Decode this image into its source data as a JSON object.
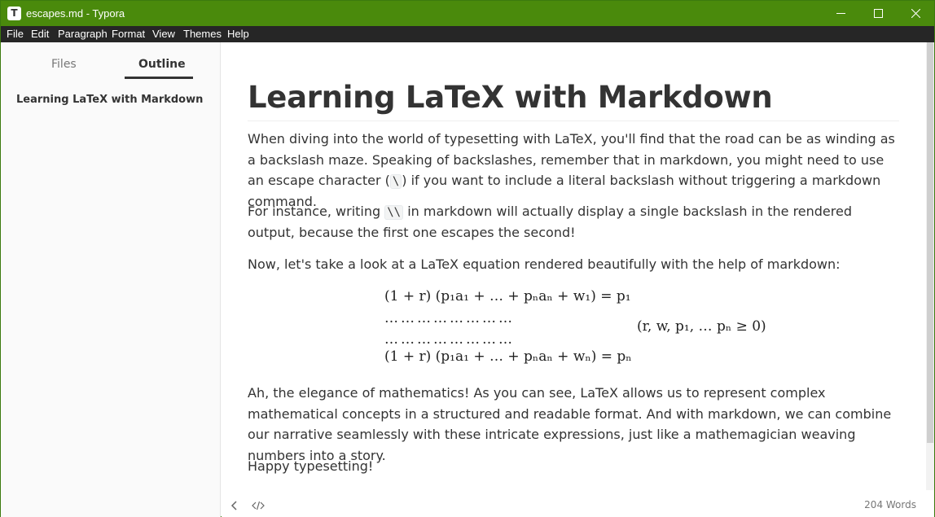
{
  "window": {
    "app_letter": "T",
    "title": "escapes.md - Typora"
  },
  "menu": [
    "File",
    "Edit",
    "Paragraph",
    "Format",
    "View",
    "Themes",
    "Help"
  ],
  "sidebar": {
    "tabs": {
      "files": "Files",
      "outline": "Outline"
    },
    "outline_items": [
      "Learning LaTeX with Markdown"
    ]
  },
  "document": {
    "title": "Learning LaTeX with Markdown",
    "p1_a": "When diving into the world of typesetting with LaTeX, you'll find that the road can be as winding as a backslash maze. Speaking of backslashes, remember that in markdown, you might need to use an escape character (",
    "p1_code": "\\",
    "p1_b": ") if you want to include a literal backslash without triggering a markdown command.",
    "p2_a": "For instance, writing ",
    "p2_code": "\\\\",
    "p2_b": " in markdown will actually display a single backslash in the rendered output, because the first one escapes the second!",
    "p3": "Now, let's take a look at a LaTeX equation rendered beautifully with the help of markdown:",
    "math": {
      "line1": "(1 + r) (p₁a₁ + … + pₙaₙ + w₁) = p₁",
      "line2": "……………………",
      "line3": "……………………",
      "line4": "(1 + r) (p₁a₁ + … + pₙaₙ + wₙ) = pₙ",
      "condition": "(r, w, p₁, … pₙ ≥ 0)"
    },
    "p4": "Ah, the elegance of mathematics! As you can see, LaTeX allows us to represent complex mathematical concepts in a structured and readable format. And with markdown, we can combine our narrative seamlessly with these intricate expressions, just like a mathemagician weaving numbers into a story.",
    "p5": "Happy typesetting!"
  },
  "status": {
    "word_count": "204 Words"
  },
  "colors": {
    "titlebar": "#4a8a0c",
    "menubar": "#262626"
  }
}
